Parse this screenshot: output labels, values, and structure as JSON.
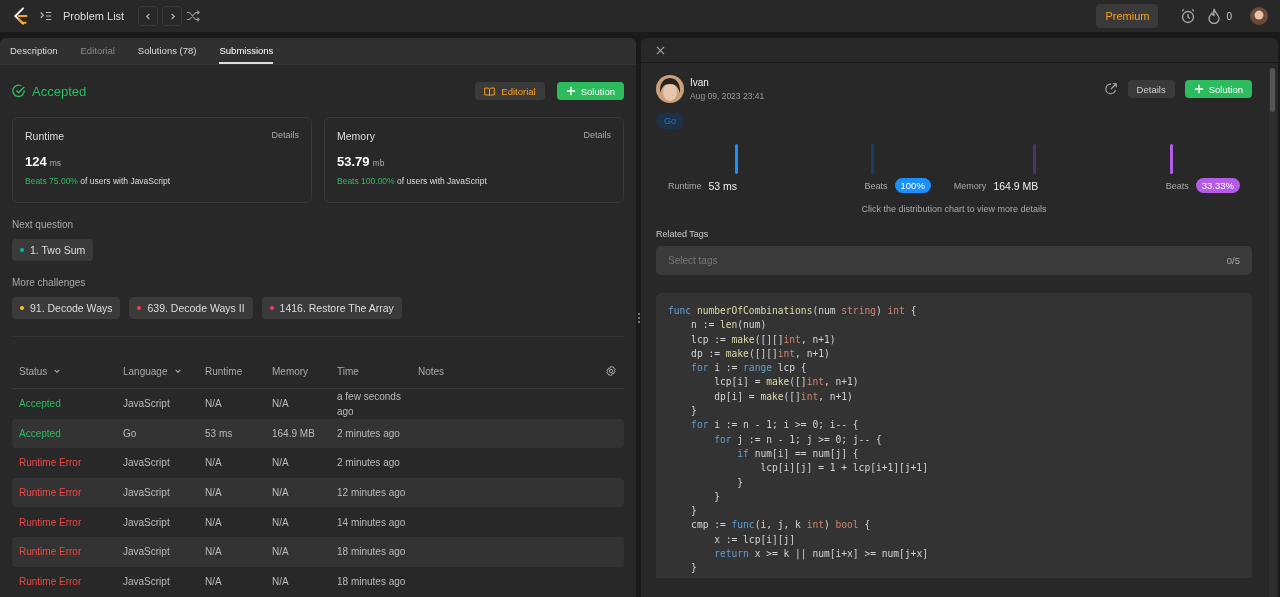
{
  "nav": {
    "title": "Problem List",
    "premium": "Premium",
    "streak": "0"
  },
  "tabs": [
    {
      "label": "Description",
      "selected": false,
      "disabled": false
    },
    {
      "label": "Editorial",
      "selected": false,
      "disabled": true
    },
    {
      "label": "Solutions (78)",
      "selected": false,
      "disabled": false
    },
    {
      "label": "Submissions",
      "selected": true,
      "disabled": false
    }
  ],
  "result": {
    "status": "Accepted",
    "editorial_button": "Editorial",
    "solution_button": "Solution"
  },
  "stats": [
    {
      "label": "Runtime",
      "details": "Details",
      "value": "124",
      "unit": "ms",
      "beats": "Beats 75.00%",
      "suffix": "of users with JavaScript"
    },
    {
      "label": "Memory",
      "details": "Details",
      "value": "53.79",
      "unit": "mb",
      "beats": "Beats 100.00%",
      "suffix": "of users with JavaScript"
    }
  ],
  "next_question": {
    "heading": "Next question",
    "items": [
      {
        "label": "1. Two Sum",
        "color": "#00b8a3"
      }
    ]
  },
  "more_challenges": {
    "heading": "More challenges",
    "items": [
      {
        "label": "91. Decode Ways",
        "color": "#ffc01e"
      },
      {
        "label": "639. Decode Ways II",
        "color": "#ff375f"
      },
      {
        "label": "1416. Restore The Array",
        "color": "#ff375f"
      }
    ]
  },
  "table": {
    "columns": [
      {
        "label": "Status",
        "sortable": true
      },
      {
        "label": "Language",
        "sortable": true
      },
      {
        "label": "Runtime",
        "sortable": false
      },
      {
        "label": "Memory",
        "sortable": false
      },
      {
        "label": "Time",
        "sortable": false
      },
      {
        "label": "Notes",
        "sortable": false
      }
    ],
    "rows": [
      {
        "status": "Accepted",
        "kind": "accepted",
        "language": "JavaScript",
        "runtime": "N/A",
        "memory": "N/A",
        "time": "a few seconds ago"
      },
      {
        "status": "Accepted",
        "kind": "accepted",
        "language": "Go",
        "runtime": "53 ms",
        "memory": "164.9 MB",
        "time": "2 minutes ago"
      },
      {
        "status": "Runtime Error",
        "kind": "error",
        "language": "JavaScript",
        "runtime": "N/A",
        "memory": "N/A",
        "time": "2 minutes ago"
      },
      {
        "status": "Runtime Error",
        "kind": "error",
        "language": "JavaScript",
        "runtime": "N/A",
        "memory": "N/A",
        "time": "12 minutes ago"
      },
      {
        "status": "Runtime Error",
        "kind": "error",
        "language": "JavaScript",
        "runtime": "N/A",
        "memory": "N/A",
        "time": "14 minutes ago"
      },
      {
        "status": "Runtime Error",
        "kind": "error",
        "language": "JavaScript",
        "runtime": "N/A",
        "memory": "N/A",
        "time": "18 minutes ago"
      },
      {
        "status": "Runtime Error",
        "kind": "error",
        "language": "JavaScript",
        "runtime": "N/A",
        "memory": "N/A",
        "time": "18 minutes ago"
      }
    ]
  },
  "detail": {
    "user": "Ivan",
    "date": "Aug 09, 2023 23:41",
    "details_button": "Details",
    "solution_button": "Solution",
    "language_tag": "Go",
    "runtime": {
      "label": "Runtime",
      "value": "53 ms",
      "beats_label": "Beats",
      "beats": "100%"
    },
    "memory": {
      "label": "Memory",
      "value": "164.9 MB",
      "beats_label": "Beats",
      "beats": "33.33%"
    },
    "hint": "Click the distribution chart to view more details",
    "tags_heading": "Related Tags",
    "tags_placeholder": "Select tags",
    "tags_count": "0/5",
    "code": [
      [
        {
          "kind": "keyword",
          "text": "func "
        },
        {
          "kind": "function",
          "text": "numberOfCombinations"
        },
        {
          "kind": "plain",
          "text": "(num "
        },
        {
          "kind": "type",
          "text": "string"
        },
        {
          "kind": "plain",
          "text": ") "
        },
        {
          "kind": "type",
          "text": "int"
        },
        {
          "kind": "plain",
          "text": " {"
        }
      ],
      [
        {
          "kind": "plain",
          "text": "    n := "
        },
        {
          "kind": "function",
          "text": "len"
        },
        {
          "kind": "plain",
          "text": "(num)"
        }
      ],
      [
        {
          "kind": "plain",
          "text": "    lcp := "
        },
        {
          "kind": "function",
          "text": "make"
        },
        {
          "kind": "plain",
          "text": "([][]"
        },
        {
          "kind": "type",
          "text": "int"
        },
        {
          "kind": "plain",
          "text": ", n+1)"
        }
      ],
      [
        {
          "kind": "plain",
          "text": "    dp := "
        },
        {
          "kind": "function",
          "text": "make"
        },
        {
          "kind": "plain",
          "text": "([][]"
        },
        {
          "kind": "type",
          "text": "int"
        },
        {
          "kind": "plain",
          "text": ", n+1)"
        }
      ],
      [
        {
          "kind": "keyword",
          "text": "    for"
        },
        {
          "kind": "plain",
          "text": " i := "
        },
        {
          "kind": "keyword",
          "text": "range"
        },
        {
          "kind": "plain",
          "text": " lcp {"
        }
      ],
      [
        {
          "kind": "plain",
          "text": "        lcp[i] = "
        },
        {
          "kind": "function",
          "text": "make"
        },
        {
          "kind": "plain",
          "text": "([]"
        },
        {
          "kind": "type",
          "text": "int"
        },
        {
          "kind": "plain",
          "text": ", n+1)"
        }
      ],
      [
        {
          "kind": "plain",
          "text": "        dp[i] = "
        },
        {
          "kind": "function",
          "text": "make"
        },
        {
          "kind": "plain",
          "text": "([]"
        },
        {
          "kind": "type",
          "text": "int"
        },
        {
          "kind": "plain",
          "text": ", n+1)"
        }
      ],
      [
        {
          "kind": "plain",
          "text": "    }"
        }
      ],
      [
        {
          "kind": "keyword",
          "text": "    for"
        },
        {
          "kind": "plain",
          "text": " i := n - 1; i >= 0; i-- {"
        }
      ],
      [
        {
          "kind": "keyword",
          "text": "        for"
        },
        {
          "kind": "plain",
          "text": " j := n - 1; j >= 0; j-- {"
        }
      ],
      [
        {
          "kind": "keyword",
          "text": "            if"
        },
        {
          "kind": "plain",
          "text": " num[i] == num[j] {"
        }
      ],
      [
        {
          "kind": "plain",
          "text": "                lcp[i][j] = 1 + lcp[i+1][j+1]"
        }
      ],
      [
        {
          "kind": "plain",
          "text": "            }"
        }
      ],
      [
        {
          "kind": "plain",
          "text": "        }"
        }
      ],
      [
        {
          "kind": "plain",
          "text": "    }"
        }
      ],
      [
        {
          "kind": "plain",
          "text": "    cmp := "
        },
        {
          "kind": "keyword",
          "text": "func"
        },
        {
          "kind": "plain",
          "text": "(i, j, k "
        },
        {
          "kind": "type",
          "text": "int"
        },
        {
          "kind": "plain",
          "text": ") "
        },
        {
          "kind": "type",
          "text": "bool"
        },
        {
          "kind": "plain",
          "text": " {"
        }
      ],
      [
        {
          "kind": "plain",
          "text": "        x := lcp[i][j]"
        }
      ],
      [
        {
          "kind": "keyword",
          "text": "        return"
        },
        {
          "kind": "plain",
          "text": " x >= k || num[i+x] >= num[j+x]"
        }
      ],
      [
        {
          "kind": "plain",
          "text": "    }"
        }
      ]
    ]
  }
}
